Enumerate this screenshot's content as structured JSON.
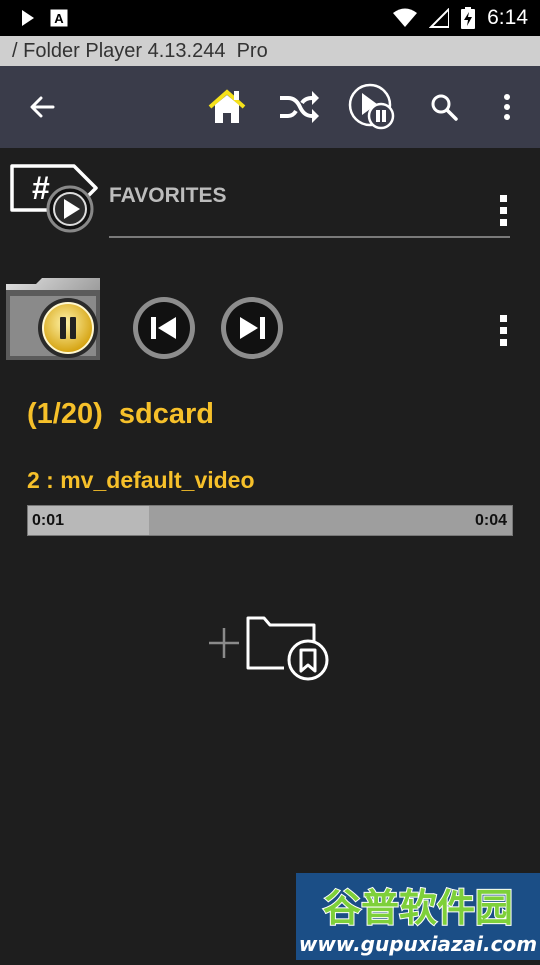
{
  "status_bar": {
    "time": "6:14",
    "icons": [
      "play-icon",
      "text-icon",
      "wifi-icon",
      "signal-icon",
      "battery-charging-icon"
    ]
  },
  "app": {
    "title": "/ Folder Player 4.13.244  Pro"
  },
  "toolbar": {
    "icons": [
      "back-arrow-icon",
      "home-icon",
      "shuffle-icon",
      "play-pause-icon",
      "search-icon",
      "more-vert-icon"
    ],
    "accent": "#f6e21a"
  },
  "favorites": {
    "label": "FAVORITES"
  },
  "player": {
    "folder_title": "(1/20)  sdcard",
    "track_title": "2 : mv_default_video",
    "elapsed": "0:01",
    "duration": "0:04",
    "progress": 0.25,
    "accent": "#f6c02a"
  },
  "watermark": {
    "text": "谷普软件园",
    "url": "www.gupuxiazai.com"
  }
}
